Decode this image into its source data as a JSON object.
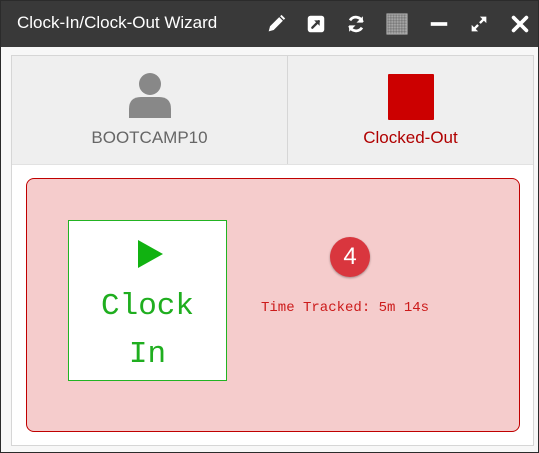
{
  "window": {
    "title": "Clock-In/Clock-Out Wizard",
    "toolbar_icons": [
      "pencil-icon",
      "open-external-icon",
      "refresh-icon",
      "texture-icon",
      "minimize-icon",
      "maximize-icon",
      "close-icon"
    ]
  },
  "user": {
    "name": "BOOTCAMP10",
    "icon": "user-icon"
  },
  "status": {
    "label": "Clocked-Out",
    "color": "#cc0000"
  },
  "clock": {
    "button_line1": "Clock",
    "button_line2": "In",
    "icon": "play-icon",
    "accent": "#1fae1f"
  },
  "badge": {
    "count": "4"
  },
  "time_tracked": {
    "text": "Time Tracked: 5m 14s"
  }
}
